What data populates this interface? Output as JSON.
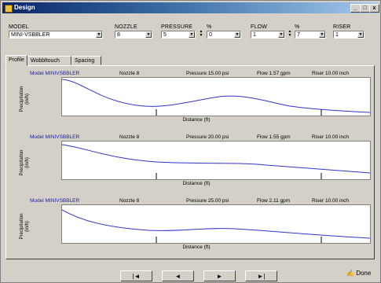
{
  "window": {
    "title": "Design",
    "min_glyph": "_",
    "max_glyph": "□",
    "close_glyph": "x"
  },
  "toolbar": {
    "model_label": "MODEL",
    "model_value": "MINI-VSBBLER",
    "nozzle_label": "NOZZLE",
    "nozzle_value": "8",
    "pressure_label": "PRESSURE",
    "pressure_value": "5",
    "pressure_pct_label": "%",
    "pressure_pct_value": "0",
    "flow_label": "FLOW",
    "flow_value": "1",
    "flow_pct_label": "%",
    "flow_pct_value": "7",
    "riser_label": "RISER",
    "riser_value": "1"
  },
  "tabs": [
    {
      "label": "Profile",
      "active": true
    },
    {
      "label": "Wobbltouch",
      "active": false
    },
    {
      "label": "Spacing",
      "active": false
    }
  ],
  "panes": [
    {
      "model": "Model MINIVSBBLER",
      "nozzle": "Nozzle 8",
      "pressure": "Pressure 15.00 psi",
      "flow": "Flow 1.57 gpm",
      "riser": "Riser 10.00 inch",
      "ylabel": "Precipitation (in/h)",
      "xlabel": "Distance (ft)"
    },
    {
      "model": "Model MINIVSBBLER",
      "nozzle": "Nozzle 8",
      "pressure": "Pressure 20.00 psi",
      "flow": "Flow 1.55 gpm",
      "riser": "Riser 10.00 inch",
      "ylabel": "Precipitation (in/h)",
      "xlabel": "Distance (ft)"
    },
    {
      "model": "Model MINIVSBBLER",
      "nozzle": "Nozzle 8",
      "pressure": "Pressure 25.00 psi",
      "flow": "Flow 2.11 gpm",
      "riser": "Riser 10.00 inch",
      "ylabel": "Precipitation (in/h)",
      "xlabel": "Distance (ft)"
    }
  ],
  "navigation": {
    "first": "|◄",
    "prev": "◄",
    "next": "►",
    "last": "►|"
  },
  "done_label": "Done"
}
